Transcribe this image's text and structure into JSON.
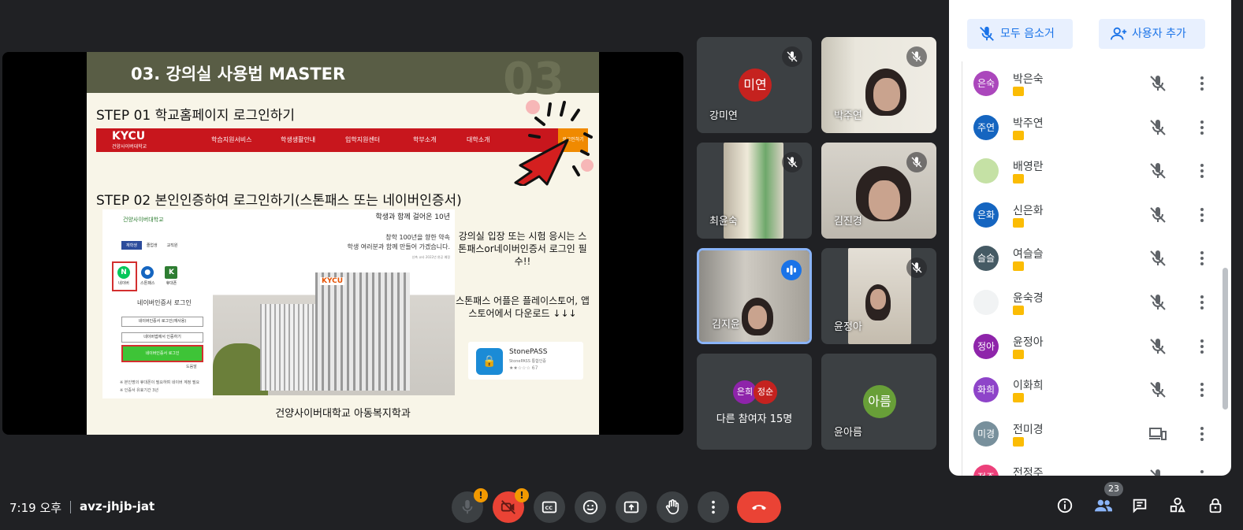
{
  "presentation": {
    "slide_title": "03. 강의실 사용법 MASTER",
    "slide_bg_number": "03",
    "step1": "STEP 01 학교홈페이지 로그인하기",
    "step2": "STEP 02 본인인증하여 로그인하기(스톤패스 또는 네이버인증서)",
    "site_logo": "KYCU",
    "site_logo_sub": "건양사이버대학교",
    "site_menu": [
      "학습지원서비스",
      "학생생활안내",
      "입학지원센터",
      "학부소개",
      "대학소개"
    ],
    "site_login": "로그인하기",
    "login_panel": {
      "logo": "건양사이버대학교",
      "tabs": [
        "재학생",
        "졸업생",
        "교직원"
      ],
      "icons": [
        "네이버",
        "스톤패스",
        "휴대폰"
      ],
      "subtitle": "네이버인증서 로그인",
      "buttons": [
        "네이버인증서 로그인(재사용)",
        "네이버앱에서 인증하기",
        "네이버인증서 로그인"
      ],
      "fine_print": [
        "※ 본인명의 휴대폰이 필요하며 네이버 계정 필요",
        "※ 인증서 유효기간 3년"
      ],
      "help": "도움말"
    },
    "ad": {
      "line1": "학생과 함께 걸어온 10년",
      "line2": "창학 100년을 향한 약속",
      "line3": "학생 여러분과 함께 만들어 가겠습니다.",
      "fine": "신축 교사 2022년 완공 예정",
      "building_sign": "KYCU"
    },
    "note1": "강의실 입장 또는 시험 응시는 스톤패스or네이버인증서 로그인 필수!!",
    "note2": "스톤패스 어플은 플레이스토어, 앱스토어에서 다운로드 ↓↓↓",
    "stonepass": {
      "name": "StonePASS",
      "sub": "StonePASS 통합인증",
      "rating": "★★☆☆☆ 67"
    },
    "footer": "건양사이버대학교 아동복지학과"
  },
  "tiles": [
    {
      "name": "강미연",
      "avatar": "미연",
      "avatar_color": "#c5221f",
      "muted": true
    },
    {
      "name": "박주연",
      "muted": true,
      "video": true
    },
    {
      "name": "최윤숙",
      "muted": true,
      "video": true
    },
    {
      "name": "김진경",
      "muted": true,
      "video": true
    },
    {
      "name": "김지윤",
      "speaking": true,
      "video": true
    },
    {
      "name": "윤정아",
      "muted": true,
      "video": true
    },
    {
      "name": "다른 참여자 15명",
      "avatars": [
        "은희",
        "정순"
      ],
      "avatar_colors": [
        "#8e24aa",
        "#c5221f"
      ]
    },
    {
      "name": "윤아름",
      "avatar": "아름",
      "avatar_color": "#689f38"
    }
  ],
  "panel": {
    "mute_all": "모두 음소거",
    "add_user": "사용자 추가",
    "people": [
      {
        "initials": "은숙",
        "name": "박은숙",
        "color": "#ab47bc",
        "status": "muted"
      },
      {
        "initials": "주연",
        "name": "박주연",
        "color": "#1565c0",
        "status": "muted"
      },
      {
        "initials": "",
        "name": "배영란",
        "color": "#c5e1a5",
        "status": "muted"
      },
      {
        "initials": "은화",
        "name": "신은화",
        "color": "#1565c0",
        "status": "muted"
      },
      {
        "initials": "슬슬",
        "name": "여슬슬",
        "color": "#455a64",
        "status": "muted"
      },
      {
        "initials": "",
        "name": "윤숙경",
        "color": "#f1f3f4",
        "status": "muted"
      },
      {
        "initials": "정아",
        "name": "윤정아",
        "color": "#8e24aa",
        "status": "muted"
      },
      {
        "initials": "화희",
        "name": "이화희",
        "color": "#8e44c9",
        "status": "muted"
      },
      {
        "initials": "미경",
        "name": "전미경",
        "color": "#78909c",
        "status": "devices"
      },
      {
        "initials": "정주",
        "name": "전정주",
        "color": "#ec407a",
        "status": "muted"
      }
    ]
  },
  "bottom": {
    "time": "7:19 오후",
    "meeting_code": "avz-jhjb-jat",
    "participant_count": "23"
  }
}
